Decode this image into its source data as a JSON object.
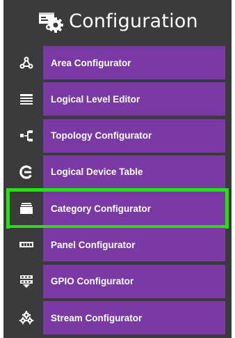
{
  "header": {
    "title": "Configuration",
    "icon": "configuration-gears-icon"
  },
  "menu": {
    "items": [
      {
        "label": "Area Configurator",
        "icon": "area-nodes-icon"
      },
      {
        "label": "Logical Level Editor",
        "icon": "layers-icon"
      },
      {
        "label": "Topology Configurator",
        "icon": "topology-icon"
      },
      {
        "label": "Logical Device Table",
        "icon": "logical-device-icon"
      },
      {
        "label": "Category Configurator",
        "icon": "category-icon",
        "selected": true
      },
      {
        "label": "Panel Configurator",
        "icon": "panel-icon"
      },
      {
        "label": "GPIO Configurator",
        "icon": "gpio-icon"
      },
      {
        "label": "Stream Configurator",
        "icon": "stream-gears-icon"
      }
    ]
  },
  "colors": {
    "panel_bg": "#3b3b3b",
    "item_bg": "#7a3aa3",
    "selection_outline": "#22e40c",
    "text": "#ffffff"
  }
}
